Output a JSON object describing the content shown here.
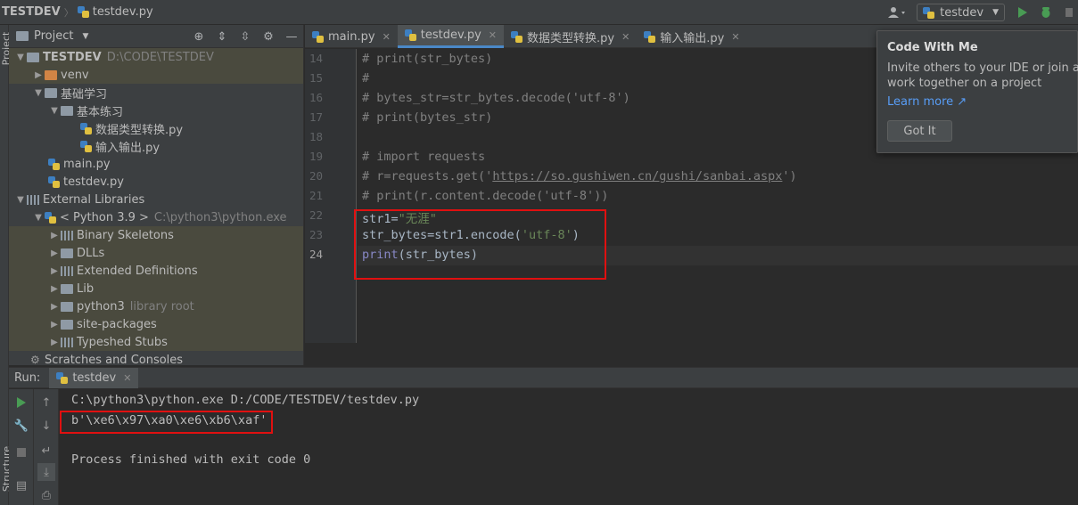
{
  "navbar": {
    "project": "TESTDEV",
    "file": "testdev.py",
    "run_config": "testdev"
  },
  "stripe": {
    "project_label": "Project",
    "structure_label": "Structure"
  },
  "project_panel": {
    "title": "Project",
    "tree": [
      {
        "label": "TESTDEV",
        "extra": "D:\\CODE\\TESTDEV"
      },
      {
        "label": "venv"
      },
      {
        "label": "基础学习"
      },
      {
        "label": "基本练习"
      },
      {
        "label": "数据类型转换.py"
      },
      {
        "label": "输入输出.py"
      },
      {
        "label": "main.py"
      },
      {
        "label": "testdev.py"
      },
      {
        "label": "External Libraries"
      },
      {
        "label": "< Python 3.9 >",
        "extra": "C:\\python3\\python.exe"
      },
      {
        "label": "Binary Skeletons"
      },
      {
        "label": "DLLs"
      },
      {
        "label": "Extended Definitions"
      },
      {
        "label": "Lib"
      },
      {
        "label": "python3",
        "extra": "library root"
      },
      {
        "label": "site-packages"
      },
      {
        "label": "Typeshed Stubs"
      },
      {
        "label": "Scratches and Consoles"
      }
    ]
  },
  "editor_tabs": [
    {
      "label": "main.py"
    },
    {
      "label": "testdev.py"
    },
    {
      "label": "数据类型转换.py"
    },
    {
      "label": "输入输出.py"
    }
  ],
  "editor": {
    "line_numbers": [
      "14",
      "15",
      "16",
      "17",
      "18",
      "19",
      "20",
      "21",
      "22",
      "23",
      "24"
    ],
    "lines": {
      "l14": "# print(str_bytes)",
      "l15": "#",
      "l16": "# bytes_str=str_bytes.decode('utf-8')",
      "l17": "# print(bytes_str)",
      "l18": "",
      "l19": "# import requests",
      "l20_a": "# r=requests.get('",
      "l20_url": "https://so.gushiwen.cn/gushi/sanbai.aspx",
      "l20_b": "')",
      "l21": "# print(r.content.decode('utf-8'))",
      "l22_a": "str1=",
      "l22_str": "\"无涯\"",
      "l23_a": "str_bytes=str1.encode(",
      "l23_str": "'utf-8'",
      "l23_b": ")",
      "l24_kw": "print",
      "l24_b": "(str_bytes)"
    }
  },
  "popup": {
    "title": "Code With Me",
    "text_line1": "Invite others to your IDE or join anot",
    "text_line2": "work together on a project",
    "link": "Learn more ↗",
    "button": "Got It"
  },
  "run": {
    "label": "Run:",
    "tab": "testdev",
    "console": [
      "C:\\python3\\python.exe D:/CODE/TESTDEV/testdev.py",
      "b'\\xe6\\x97\\xa0\\xe6\\xb6\\xaf'",
      "",
      "Process finished with exit code 0"
    ]
  },
  "colors": {
    "accent_blue": "#4a88c7",
    "highlight_red": "#e01010",
    "run_green": "#499c54"
  }
}
